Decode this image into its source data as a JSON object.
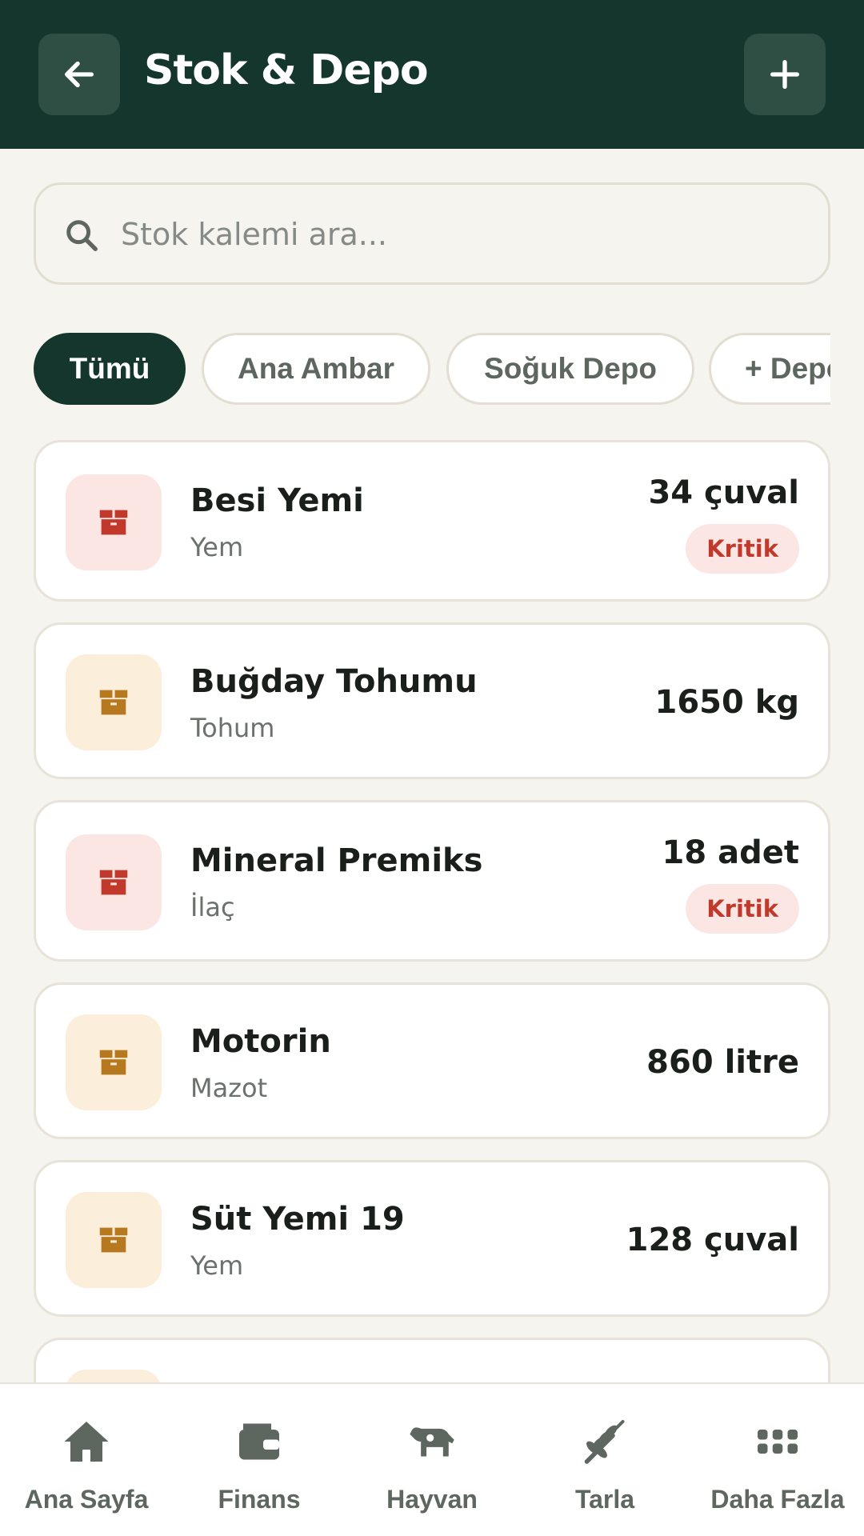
{
  "header": {
    "title": "Stok & Depo",
    "back_icon": "arrow-left-icon",
    "add_icon": "plus-icon"
  },
  "search": {
    "placeholder": "Stok kalemi ara...",
    "icon": "search-icon"
  },
  "filters": [
    {
      "label": "Tümü",
      "active": true
    },
    {
      "label": "Ana Ambar",
      "active": false
    },
    {
      "label": "Soğuk Depo",
      "active": false
    },
    {
      "label": "+ Depo Ekle",
      "active": false
    }
  ],
  "items": [
    {
      "name": "Besi Yemi",
      "category": "Yem",
      "quantity": "34 çuval",
      "badge": "Kritik",
      "critical": true
    },
    {
      "name": "Buğday Tohumu",
      "category": "Tohum",
      "quantity": "1650 kg",
      "badge": null,
      "critical": false
    },
    {
      "name": "Mineral Premiks",
      "category": "İlaç",
      "quantity": "18 adet",
      "badge": "Kritik",
      "critical": true
    },
    {
      "name": "Motorin",
      "category": "Mazot",
      "quantity": "860 litre",
      "badge": null,
      "critical": false
    },
    {
      "name": "Süt Yemi 19",
      "category": "Yem",
      "quantity": "128 çuval",
      "badge": null,
      "critical": false
    }
  ],
  "nav": [
    {
      "label": "Ana Sayfa",
      "icon": "home-icon"
    },
    {
      "label": "Finans",
      "icon": "wallet-icon"
    },
    {
      "label": "Hayvan",
      "icon": "cow-icon"
    },
    {
      "label": "Tarla",
      "icon": "wheat-icon"
    },
    {
      "label": "Daha Fazla",
      "icon": "grid-icon"
    }
  ],
  "colors": {
    "header_bg": "#14362c",
    "critical": "#c0392b",
    "normal": "#b7791f",
    "nav_icon": "#5e6660"
  }
}
